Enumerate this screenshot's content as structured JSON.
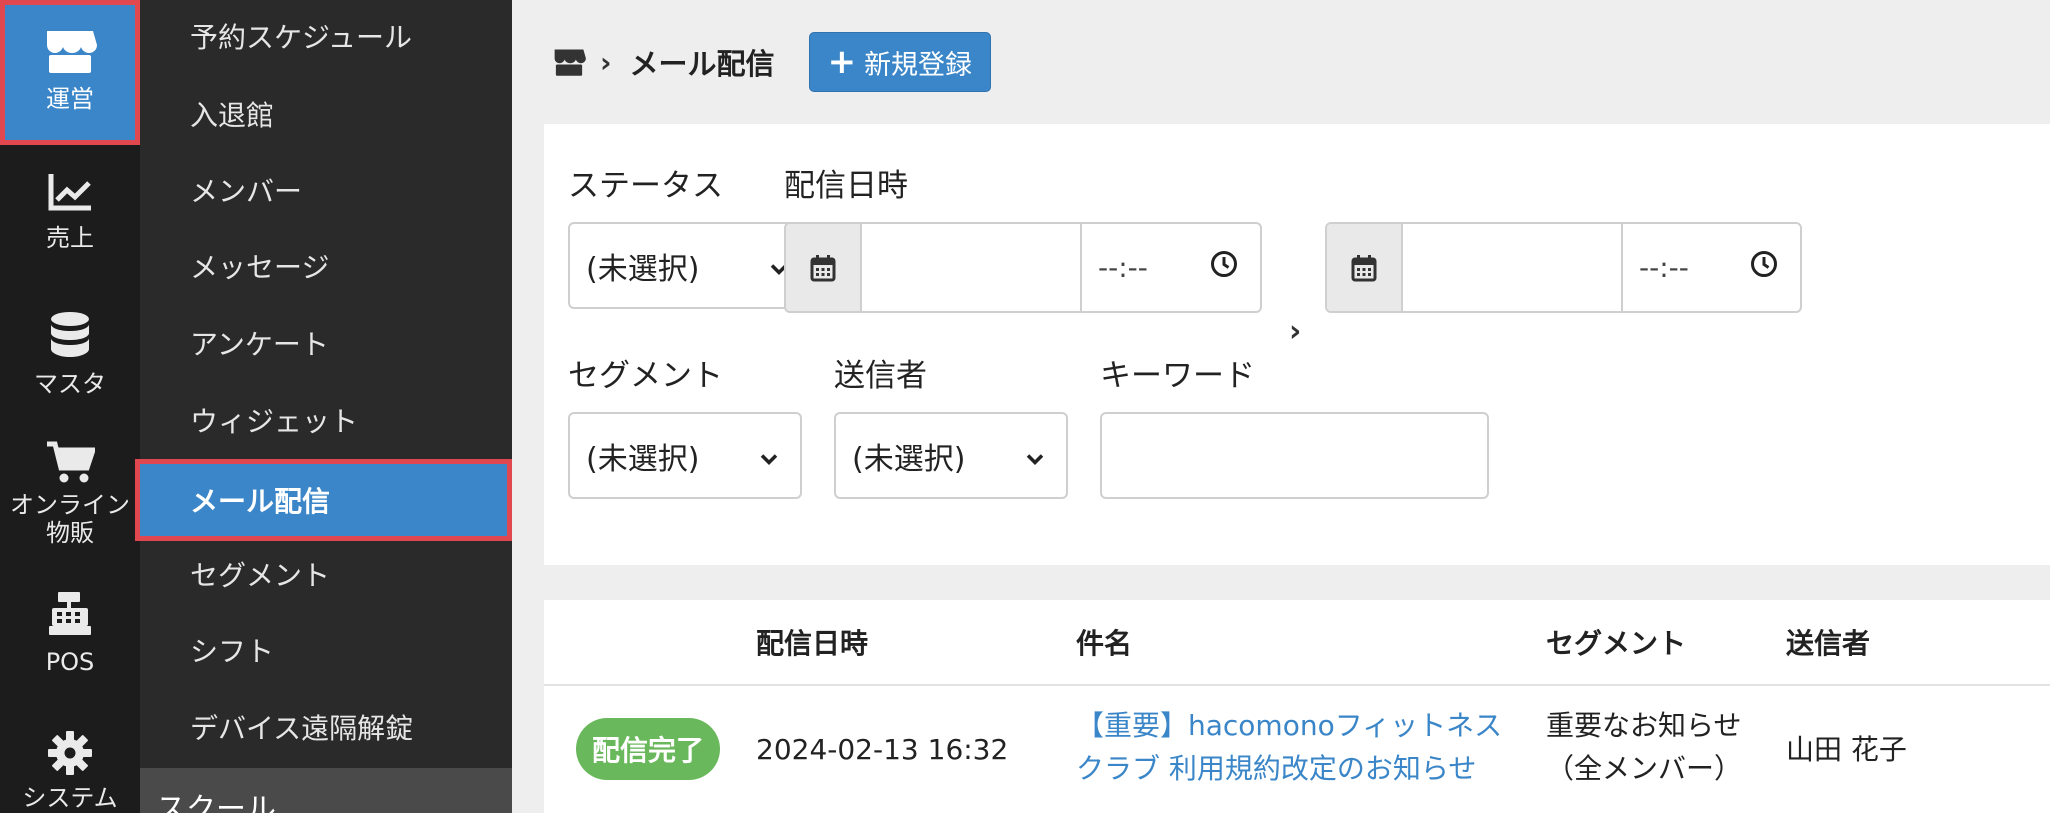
{
  "rail": {
    "items": [
      {
        "label": "運営",
        "icon": "store-icon"
      },
      {
        "label": "売上",
        "icon": "chart-line-icon"
      },
      {
        "label": "マスタ",
        "icon": "database-icon"
      },
      {
        "label": "オンライン\n物販",
        "icon": "cart-icon"
      },
      {
        "label": "POS",
        "icon": "cash-register-icon"
      },
      {
        "label": "システム",
        "icon": "gear-icon"
      }
    ]
  },
  "subnav": {
    "items": [
      {
        "label": "予約スケジュール"
      },
      {
        "label": "入退館"
      },
      {
        "label": "メンバー"
      },
      {
        "label": "メッセージ"
      },
      {
        "label": "アンケート"
      },
      {
        "label": "ウィジェット"
      },
      {
        "label": "メール配信"
      },
      {
        "label": "セグメント"
      },
      {
        "label": "シフト"
      },
      {
        "label": "デバイス遠隔解錠"
      }
    ],
    "section_label": "スクール"
  },
  "header": {
    "title": "メール配信",
    "new_button_label": "新規登録",
    "new_button_icon": "+"
  },
  "filters": {
    "status_label": "ステータス",
    "status_value": "(未選択)",
    "datetime_label": "配信日時",
    "time_placeholder_from": "--:--",
    "time_placeholder_to": "--:--",
    "segment_label": "セグメント",
    "segment_value": "(未選択)",
    "sender_label": "送信者",
    "sender_value": "(未選択)",
    "keyword_label": "キーワード",
    "keyword_value": ""
  },
  "table": {
    "headers": {
      "datetime": "配信日時",
      "subject": "件名",
      "segment": "セグメント",
      "sender": "送信者"
    },
    "rows": [
      {
        "status": "配信完了",
        "datetime": "2024-02-13 16:32",
        "subject_line1": "【重要】hacomonoフィットネス",
        "subject_line2": "クラブ 利用規約改定のお知らせ",
        "segment_line1": "重要なお知らせ",
        "segment_line2": "（全メンバー）",
        "sender": "山田 花子"
      }
    ]
  },
  "colors": {
    "accent": "#3a86c8",
    "highlight_border": "#e0474f",
    "success": "#6ab85c"
  }
}
